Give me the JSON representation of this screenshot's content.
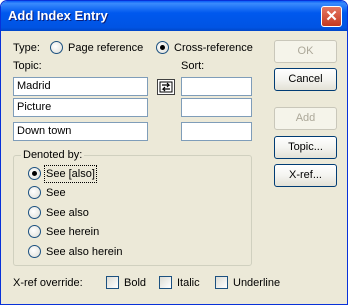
{
  "window": {
    "title": "Add Index Entry"
  },
  "type_row": {
    "label": "Type:",
    "options": [
      {
        "label": "Page reference",
        "selected": false
      },
      {
        "label": "Cross-reference",
        "selected": true
      }
    ]
  },
  "topic": {
    "label": "Topic:",
    "fields": [
      "Madrid",
      "Picture",
      "Down town"
    ]
  },
  "sort": {
    "label": "Sort:",
    "fields": [
      "",
      "",
      ""
    ]
  },
  "denoted_by": {
    "label": "Denoted by:",
    "options": [
      {
        "label": "See [also]",
        "selected": true
      },
      {
        "label": "See",
        "selected": false
      },
      {
        "label": "See also",
        "selected": false
      },
      {
        "label": "See herein",
        "selected": false
      },
      {
        "label": "See also herein",
        "selected": false
      }
    ]
  },
  "xref_override": {
    "label": "X-ref override:",
    "options": [
      {
        "label": "Bold",
        "checked": false
      },
      {
        "label": "Italic",
        "checked": false
      },
      {
        "label": "Underline",
        "checked": false
      }
    ]
  },
  "buttons": {
    "ok": {
      "label": "OK",
      "enabled": false
    },
    "cancel": {
      "label": "Cancel",
      "enabled": true
    },
    "add": {
      "label": "Add",
      "enabled": false
    },
    "topic": {
      "label": "Topic...",
      "enabled": true
    },
    "xref": {
      "label": "X-ref...",
      "enabled": true
    }
  },
  "colors": {
    "titlebar": "#0054e3",
    "dialog_bg": "#ece9d8",
    "close_button": "#c4381f"
  },
  "icons": {
    "close": "close-icon",
    "swap": "swap-arrows-icon"
  }
}
